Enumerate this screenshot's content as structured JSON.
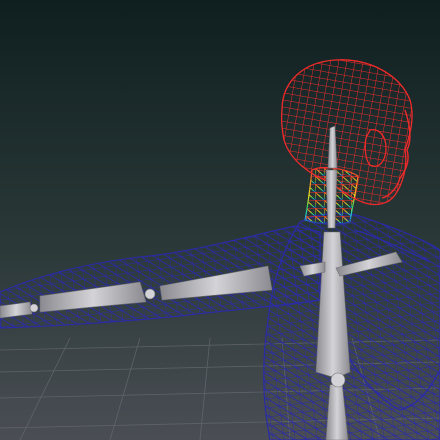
{
  "viewport": {
    "name": "3D viewport",
    "background_top": "#0f1f1f",
    "background_bottom": "#4a4e54",
    "floor_grid_color": "#6b6f75"
  },
  "model": {
    "type": "human wireframe with skin-weight paint",
    "mesh_color": "#2b2ba6",
    "weighted_region_color": "#f02a2a",
    "gradient_colors": [
      "#f02a2a",
      "#f0a020",
      "#e8e020",
      "#3ad060",
      "#20c0e0",
      "#2b2ba6"
    ],
    "bone_color": "#c8c8cc",
    "bone_shadow_color": "#8a8a90"
  }
}
